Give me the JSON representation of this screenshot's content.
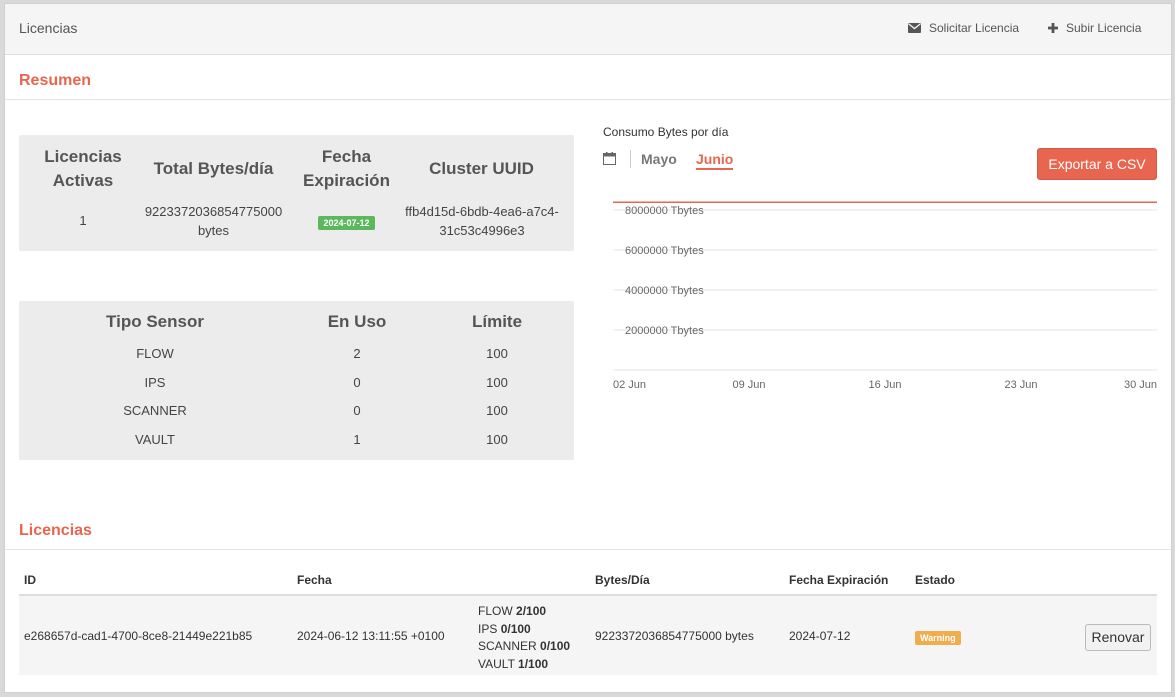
{
  "header": {
    "title": "Licencias",
    "request_label": "Solicitar Licencia",
    "upload_label": "Subir Licencia"
  },
  "summary": {
    "title": "Resumen",
    "license_table": {
      "headers": [
        "Licencias Activas",
        "Total Bytes/día",
        "Fecha Expiración",
        "Cluster UUID"
      ],
      "active": "1",
      "total_bytes": "9223372036854775000 bytes",
      "expiration": "2024-07-12",
      "cluster_uuid": "ffb4d15d-6bdb-4ea6-a7c4-31c53c4996e3"
    },
    "sensor_table": {
      "headers": [
        "Tipo Sensor",
        "En Uso",
        "Límite"
      ],
      "rows": [
        {
          "type": "FLOW",
          "in_use": "2",
          "limit": "100"
        },
        {
          "type": "IPS",
          "in_use": "0",
          "limit": "100"
        },
        {
          "type": "SCANNER",
          "in_use": "0",
          "limit": "100"
        },
        {
          "type": "VAULT",
          "in_use": "1",
          "limit": "100"
        }
      ]
    }
  },
  "chart_section": {
    "title": "Consumo Bytes por día",
    "tabs": [
      "Mayo",
      "Junio"
    ],
    "active_tab": "Junio",
    "export_label": "Exportar a CSV"
  },
  "chart_data": {
    "type": "line",
    "x_ticks": [
      "02 Jun",
      "09 Jun",
      "16 Jun",
      "23 Jun",
      "30 Jun"
    ],
    "y_ticks": [
      "8000000 Tbytes",
      "6000000 Tbytes",
      "4000000 Tbytes",
      "2000000 Tbytes"
    ],
    "y_tick_values": [
      8000000,
      6000000,
      4000000,
      2000000
    ],
    "ylim": [
      0,
      8400000
    ],
    "series": [
      {
        "color": "#e8654f",
        "x": [
          "02 Jun",
          "30 Jun"
        ],
        "values": [
          8388608,
          8388608
        ]
      }
    ],
    "grid": true
  },
  "licenses": {
    "title": "Licencias",
    "columns": [
      "ID",
      "Fecha",
      "",
      "Bytes/Día",
      "Fecha Expiración",
      "Estado"
    ],
    "rows": [
      {
        "id": "e268657d-cad1-4700-8ce8-21449e221b85",
        "date": "2024-06-12 13:11:55 +0100",
        "sensors": [
          {
            "name": "FLOW",
            "value": "2/100"
          },
          {
            "name": "IPS",
            "value": "0/100"
          },
          {
            "name": "SCANNER",
            "value": "0/100"
          },
          {
            "name": "VAULT",
            "value": "1/100"
          }
        ],
        "bytes": "9223372036854775000 bytes",
        "expiration": "2024-07-12",
        "status": "Warning",
        "renew_label": "Renovar"
      }
    ]
  },
  "colors": {
    "accent": "#e8654f",
    "success": "#5cb85c",
    "warning": "#f0ad4e"
  }
}
